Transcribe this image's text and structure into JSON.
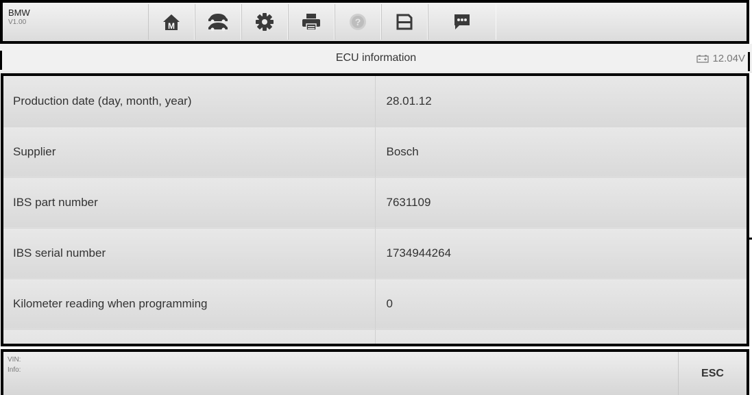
{
  "toolbar": {
    "make": "BMW",
    "version": "V1.00",
    "buttons": [
      {
        "icon": "home-icon",
        "badge": "M"
      },
      {
        "icon": "vehicle-swap-icon"
      },
      {
        "icon": "gear-icon"
      },
      {
        "icon": "printer-icon"
      },
      {
        "icon": "help-icon"
      },
      {
        "icon": "save-icon"
      },
      {
        "icon": "message-icon"
      }
    ]
  },
  "header": {
    "title": "ECU information",
    "voltage": "12.04V"
  },
  "table": {
    "rows": [
      {
        "label": "Production date (day, month, year)",
        "value": "28.01.12"
      },
      {
        "label": "Supplier",
        "value": "Bosch"
      },
      {
        "label": "IBS part number",
        "value": "7631109"
      },
      {
        "label": "IBS serial number",
        "value": "1734944264"
      },
      {
        "label": "Kilometer reading when programming",
        "value": "0"
      }
    ]
  },
  "footer": {
    "vin_label": "VIN:",
    "info_label": "Info:",
    "esc_label": "ESC"
  },
  "colors": {
    "frame": "#000000",
    "row_bg": "#e1e1e1",
    "icon": "#3a3a3a",
    "accent_red": "#c0392b"
  }
}
